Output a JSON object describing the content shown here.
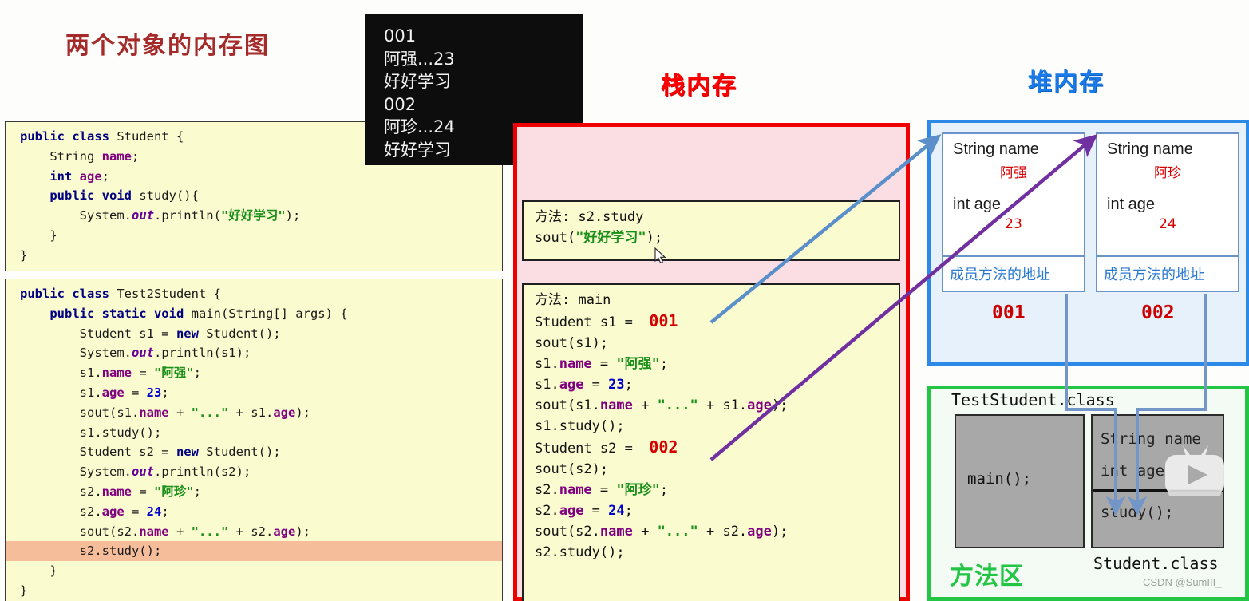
{
  "slide": {
    "title": "两个对象的内存图",
    "title_color": "#a52a2a"
  },
  "section_titles": {
    "stack": "栈内存",
    "stack_color": "#ff0000",
    "heap": "堆内存",
    "heap_color": "#1a7ae8",
    "method_area": "方法区",
    "method_area_color": "#22c544"
  },
  "console": {
    "lines": [
      "001",
      "阿强...23",
      "好好学习",
      "002",
      "阿珍...24",
      "好好学习"
    ],
    "background": "#0d0d0d",
    "text_color": "#f2f2f2"
  },
  "code_student": {
    "lines": [
      "public class Student {",
      "    String name;",
      "    int age;",
      "    public void study(){",
      "        System.out.println(\"好好学习\");",
      "    }",
      "}"
    ]
  },
  "code_test": {
    "lines": [
      "public class Test2Student {",
      "    public static void main(String[] args) {",
      "        Student s1 = new Student();",
      "        System.out.println(s1);",
      "        s1.name = \"阿强\";",
      "        s1.age = 23;",
      "        sout(s1.name + \"...\" + s1.age);",
      "        s1.study();",
      "        Student s2 = new Student();",
      "        System.out.println(s2);",
      "        s2.name = \"阿珍\";",
      "        s2.age = 24;",
      "        sout(s2.name + \"...\" + s2.age);",
      "        s2.study();",
      "    }",
      "}"
    ],
    "highlighted_line": "        s2.study();",
    "highlight_color": "#f6bd9b"
  },
  "stack": {
    "frame_study": {
      "header": "方法: s2.study",
      "body": "sout(\"好好学习\");"
    },
    "frame_main": {
      "header": "方法: main",
      "lines": [
        "Student s1 =  001",
        "sout(s1);",
        "s1.name = \"阿强\";",
        "s1.age = 23;",
        "sout(s1.name + \"...\" + s1.age);",
        "s1.study();",
        "Student s2 =  002",
        "sout(s2);",
        "s2.name = \"阿珍\";",
        "s2.age = 24;",
        "sout(s2.name + \"...\" + s2.age);",
        "s2.study();"
      ],
      "s1_address": "001",
      "s2_address": "002"
    }
  },
  "heap": {
    "objects": [
      {
        "name_field": "String name",
        "name_value": "阿强",
        "age_field": "int age",
        "age_value": "23",
        "method_ref": "成员方法的地址",
        "address": "001"
      },
      {
        "name_field": "String name",
        "name_value": "阿珍",
        "age_field": "int age",
        "age_value": "24",
        "method_ref": "成员方法的地址",
        "address": "002"
      }
    ]
  },
  "method_area": {
    "test_class_label": "TestStudent.class",
    "student_class_label": "Student.class",
    "main_entry": "main();",
    "student_fields": [
      "String name",
      "int age"
    ],
    "student_method": "study();"
  },
  "watermark": {
    "text": "CSDN @SumIII_"
  },
  "arrows": {
    "s1_to_heap_color": "#5b8fc9",
    "s2_to_heap_color": "#7030a0",
    "method_link_color": "#7396c8"
  }
}
